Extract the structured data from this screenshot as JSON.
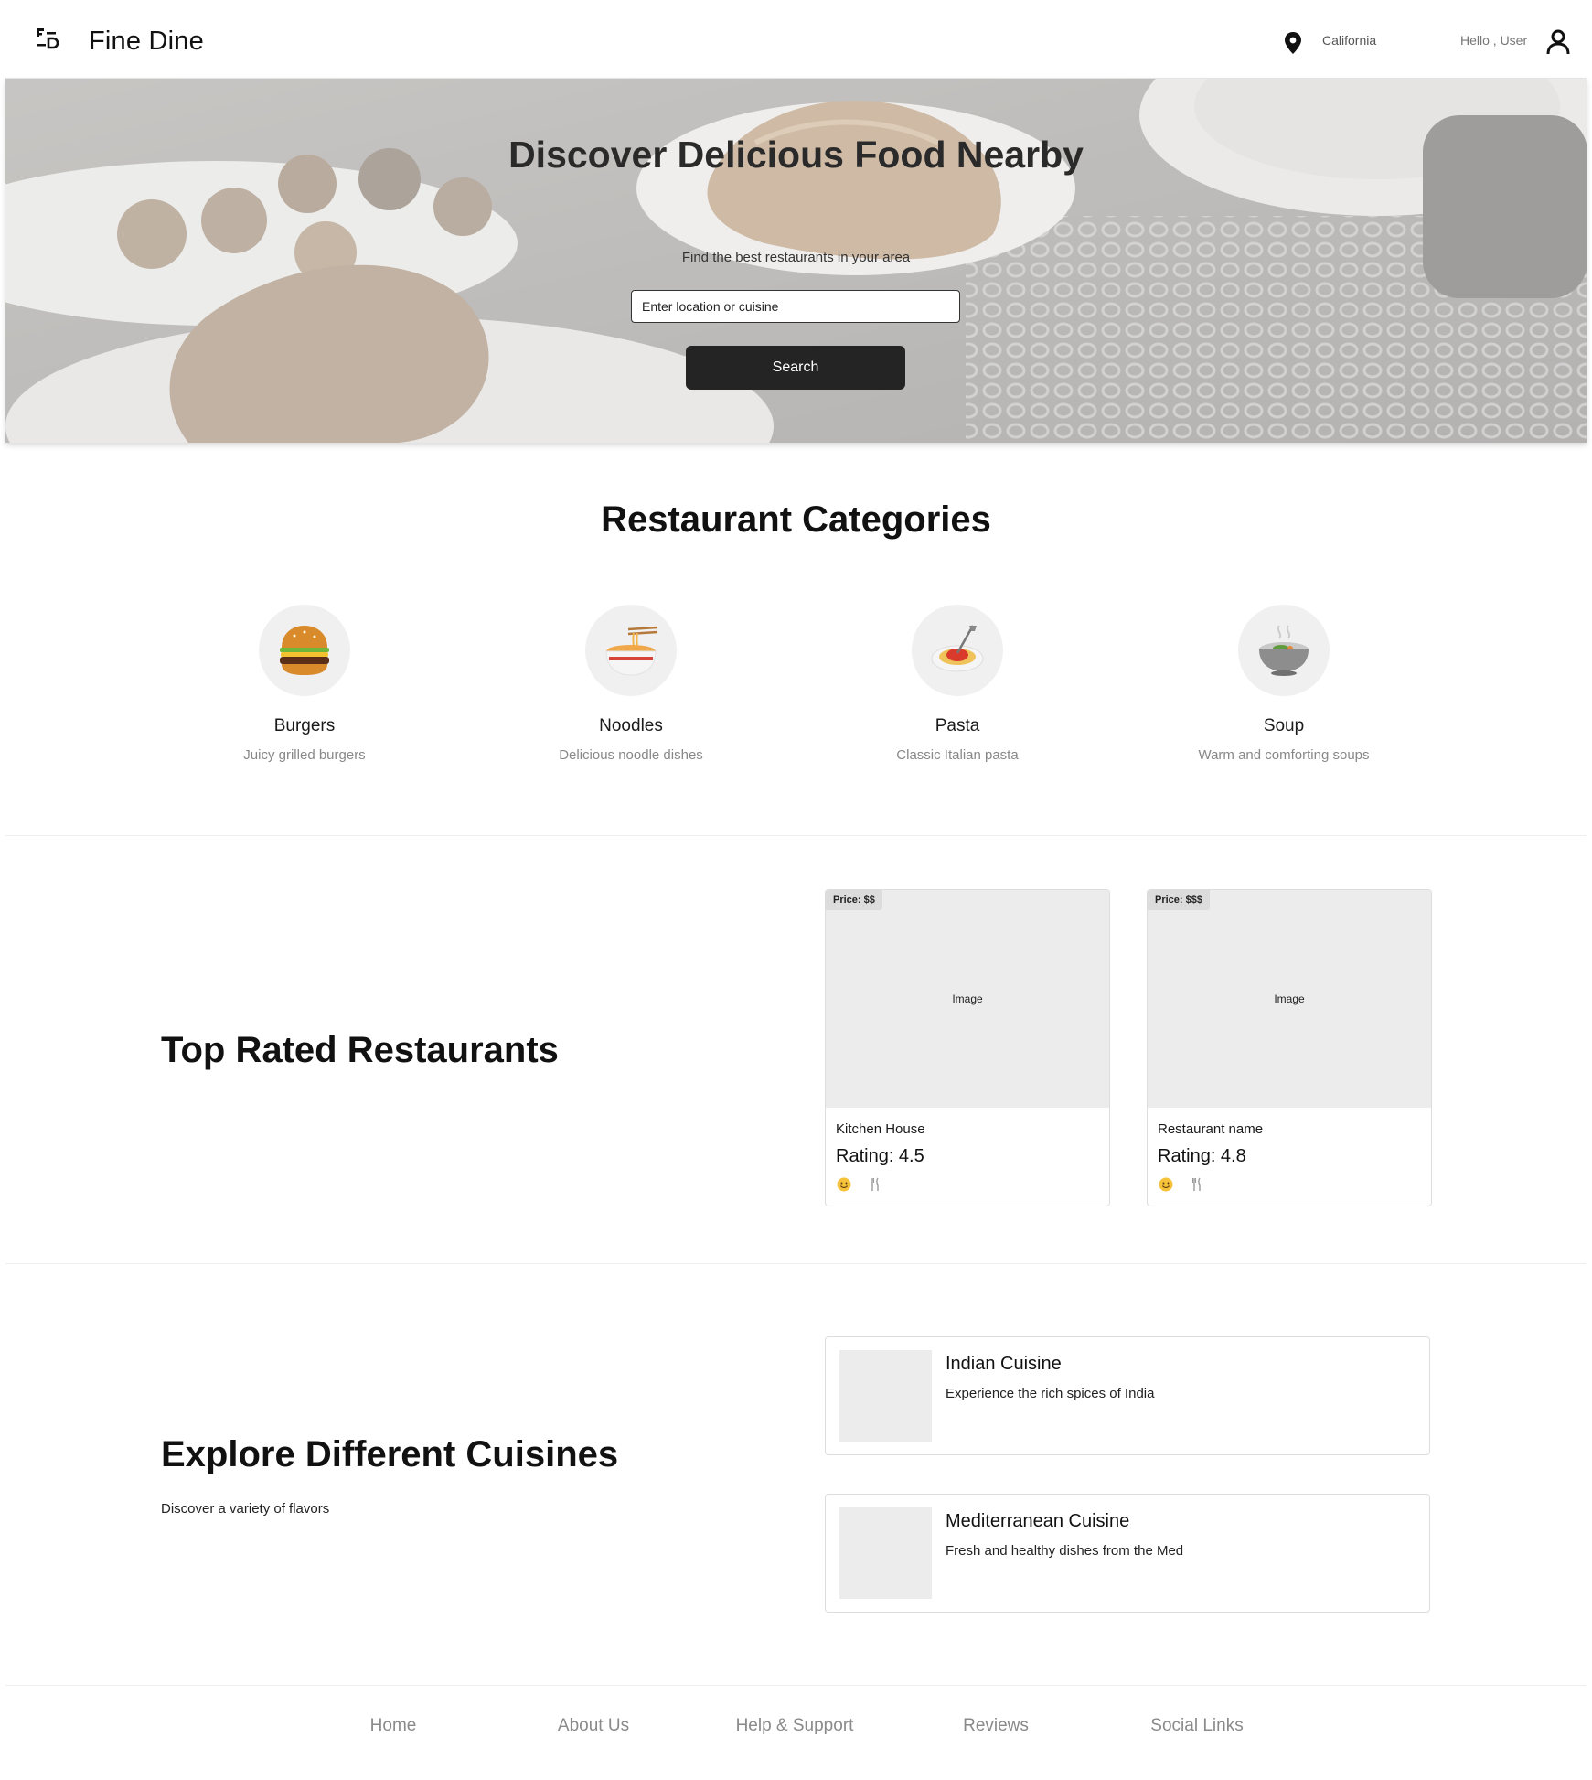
{
  "header": {
    "brand": "Fine Dine",
    "location": "California",
    "greeting": "Hello , User"
  },
  "hero": {
    "title": "Discover Delicious Food Nearby",
    "subtitle": "Find the best restaurants in your area",
    "search_placeholder": "Enter location or cuisine",
    "search_button": "Search"
  },
  "categories": {
    "title": "Restaurant Categories",
    "items": [
      {
        "name": "Burgers",
        "desc": "Juicy grilled burgers",
        "icon": "burger-icon"
      },
      {
        "name": "Noodles",
        "desc": "Delicious noodle dishes",
        "icon": "noodles-icon"
      },
      {
        "name": "Pasta",
        "desc": "Classic Italian pasta",
        "icon": "pasta-icon"
      },
      {
        "name": "Soup",
        "desc": "Warm and comforting soups",
        "icon": "soup-icon"
      }
    ]
  },
  "top_rated": {
    "title": "Top Rated Restaurants",
    "cards": [
      {
        "price": "Price: $$",
        "image_label": "Image",
        "name": "Kitchen House",
        "rating": "Rating: 4.5"
      },
      {
        "price": "Price: $$$",
        "image_label": "Image",
        "name": "Restaurant name",
        "rating": "Rating: 4.8"
      }
    ]
  },
  "cuisines": {
    "title": "Explore Different Cuisines",
    "subtitle": "Discover a variety of flavors",
    "items": [
      {
        "title": "Indian Cuisine",
        "desc": "Experience the rich spices of India"
      },
      {
        "title": "Mediterranean Cuisine",
        "desc": "Fresh and healthy dishes from the Med"
      }
    ]
  },
  "footer": {
    "links": [
      "Home",
      "About Us",
      "Help & Support",
      "Reviews",
      "Social Links"
    ]
  },
  "colors": {
    "primary_button": "#242424",
    "card_placeholder": "#ececec",
    "muted_text": "#888888"
  }
}
